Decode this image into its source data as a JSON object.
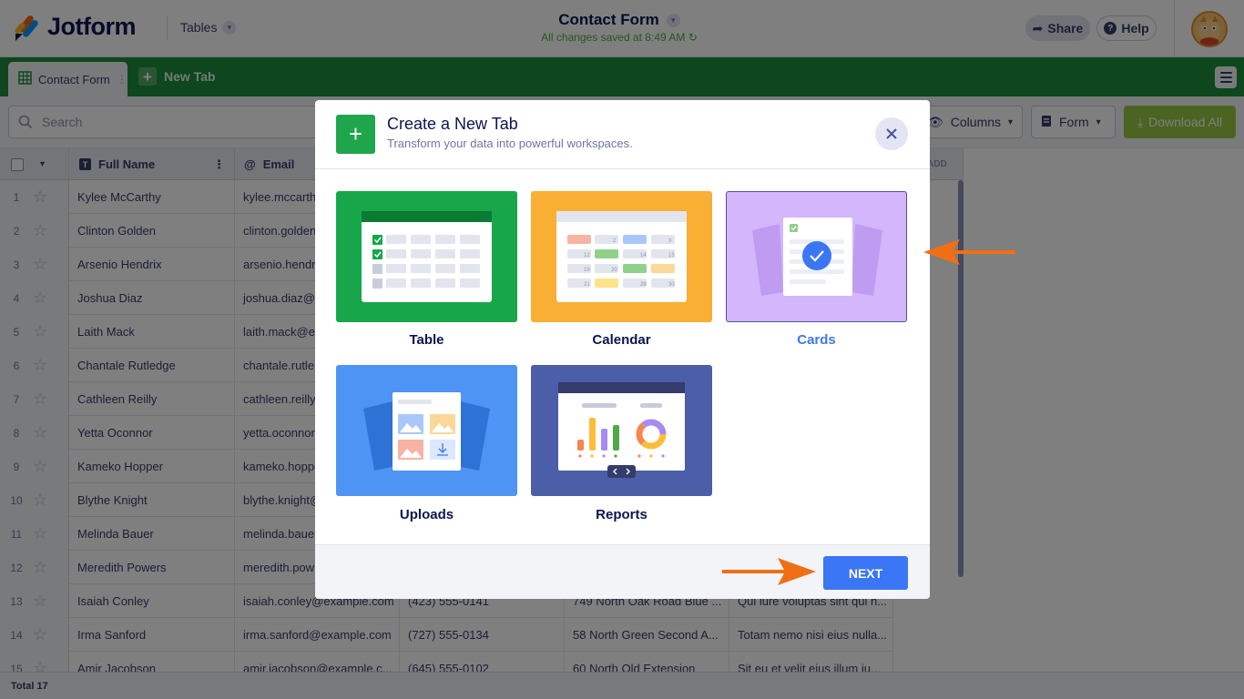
{
  "app": {
    "logo_text": "Jotform",
    "tables_label": "Tables"
  },
  "header": {
    "title": "Contact Form",
    "saved_status": "All changes saved at 8:49 AM",
    "share_label": "Share",
    "help_label": "Help"
  },
  "tabs": {
    "active_label": "Contact Form",
    "new_tab_label": "New Tab"
  },
  "toolbar": {
    "search_placeholder": "Search",
    "columns_label": "Columns",
    "form_label": "Form",
    "download_label": "Download All"
  },
  "table": {
    "headers": {
      "full_name": "Full Name",
      "email": "Email",
      "add": "ADD"
    },
    "rows": [
      {
        "num": "1",
        "name": "Kylee McCarthy",
        "email": "kylee.mccarth",
        "phone": "",
        "address": "",
        "message": ""
      },
      {
        "num": "2",
        "name": "Clinton Golden",
        "email": "clinton.golden",
        "phone": "",
        "address": "",
        "message": ""
      },
      {
        "num": "3",
        "name": "Arsenio Hendrix",
        "email": "arsenio.hendri",
        "phone": "",
        "address": "",
        "message": ""
      },
      {
        "num": "4",
        "name": "Joshua Diaz",
        "email": "joshua.diaz@e",
        "phone": "",
        "address": "",
        "message": ""
      },
      {
        "num": "5",
        "name": "Laith Mack",
        "email": "laith.mack@ex",
        "phone": "",
        "address": "",
        "message": ""
      },
      {
        "num": "6",
        "name": "Chantale Rutledge",
        "email": "chantale.rutle",
        "phone": "",
        "address": "",
        "message": ""
      },
      {
        "num": "7",
        "name": "Cathleen Reilly",
        "email": "cathleen.reilly",
        "phone": "",
        "address": "",
        "message": ""
      },
      {
        "num": "8",
        "name": "Yetta Oconnor",
        "email": "yetta.oconnor",
        "phone": "",
        "address": "",
        "message": ""
      },
      {
        "num": "9",
        "name": "Kameko Hopper",
        "email": "kameko.hoppe",
        "phone": "",
        "address": "",
        "message": ""
      },
      {
        "num": "10",
        "name": "Blythe Knight",
        "email": "blythe.knight@",
        "phone": "",
        "address": "",
        "message": ""
      },
      {
        "num": "11",
        "name": "Melinda Bauer",
        "email": "melinda.bauer",
        "phone": "",
        "address": "",
        "message": ""
      },
      {
        "num": "12",
        "name": "Meredith Powers",
        "email": "meredith.pow",
        "phone": "",
        "address": "",
        "message": ""
      },
      {
        "num": "13",
        "name": "Isaiah Conley",
        "email": "isaiah.conley@example.com",
        "phone": "(423) 555-0141",
        "address": "749 North Oak Road Blue ...",
        "message": "Qui iure voluptas sint qui h..."
      },
      {
        "num": "14",
        "name": "Irma Sanford",
        "email": "irma.sanford@example.com",
        "phone": "(727) 555-0134",
        "address": "58 North Green Second A...",
        "message": "Totam nemo nisi eius nulla..."
      },
      {
        "num": "15",
        "name": "Amir Jacobson",
        "email": "amir.jacobson@example.c...",
        "phone": "(645) 555-0102",
        "address": "60 North Old Extension",
        "message": "Sit eu et velit eius illum iu..."
      }
    ],
    "total_label": "Total 17"
  },
  "modal": {
    "title": "Create a New Tab",
    "subtitle": "Transform your data into powerful workspaces.",
    "options": [
      {
        "label": "Table",
        "color": "#17a74a",
        "selected": false
      },
      {
        "label": "Calendar",
        "color": "#f9ae34",
        "selected": false
      },
      {
        "label": "Cards",
        "color": "#d3b6fb",
        "selected": true
      },
      {
        "label": "Uploads",
        "color": "#4d94f5",
        "selected": false
      },
      {
        "label": "Reports",
        "color": "#4c5ea7",
        "selected": false
      }
    ],
    "next_label": "NEXT",
    "calendar_numbers": [
      "2",
      "3",
      "12",
      "14",
      "15",
      "19",
      "20",
      "21",
      "28",
      "30"
    ]
  },
  "annotation_color": "#f06f14"
}
